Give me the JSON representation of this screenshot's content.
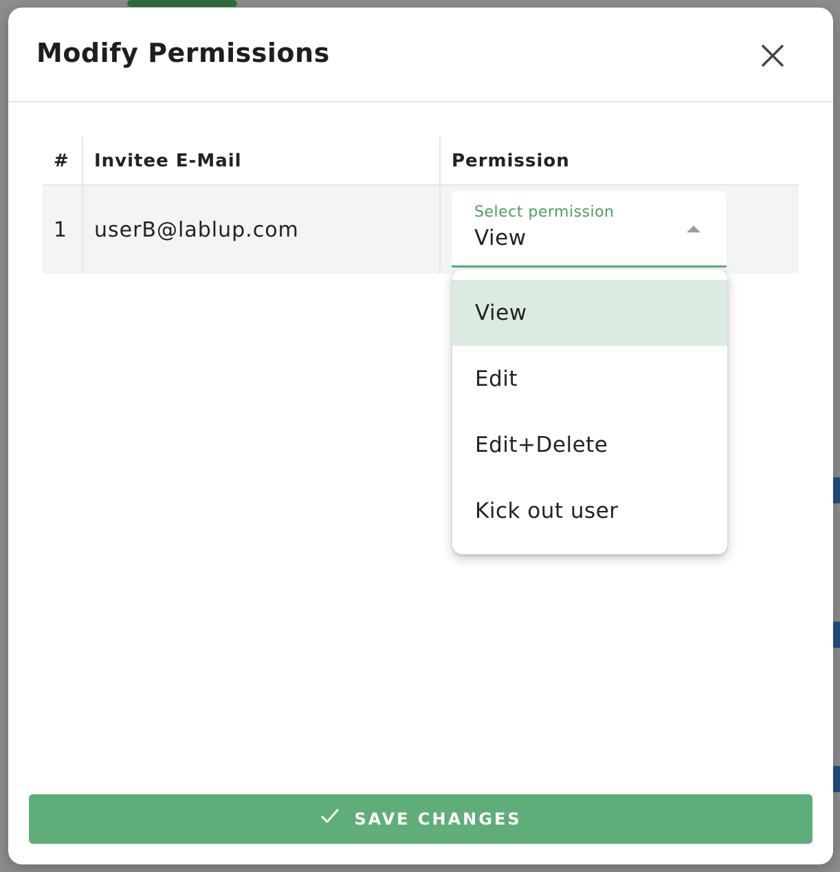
{
  "dialog": {
    "title": "Modify Permissions",
    "close_icon": "close-icon"
  },
  "table": {
    "headers": [
      "#",
      "Invitee E-Mail",
      "Permission"
    ],
    "rows": [
      {
        "index": "1",
        "email": "userB@lablup.com",
        "permission": "View"
      }
    ]
  },
  "permission_select": {
    "label": "Select permission",
    "value": "View",
    "options": [
      "View",
      "Edit",
      "Edit+Delete",
      "Kick out user"
    ],
    "selected_index": 0
  },
  "save_button": {
    "icon": "check-icon",
    "label": "SAVE CHANGES"
  },
  "colors": {
    "accent": "#5fae79",
    "accent_text": "#4f9d63",
    "selected_bg": "#dcebe0",
    "row_bg": "#f3f4f6"
  }
}
